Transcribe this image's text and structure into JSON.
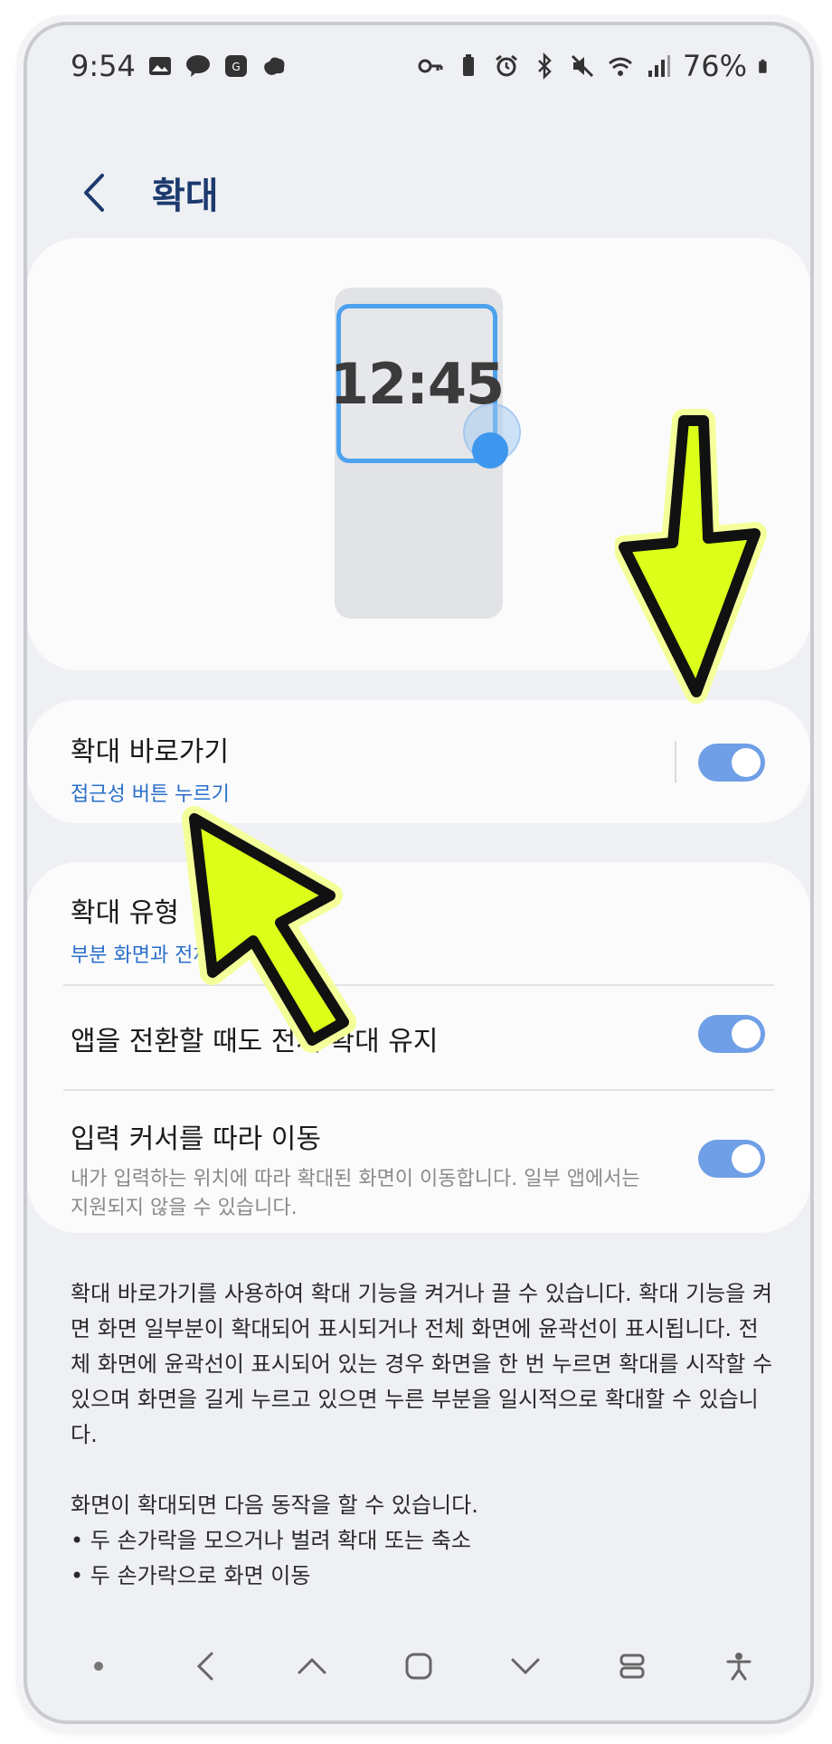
{
  "status_bar": {
    "time": "9:54",
    "battery": "76%",
    "left_icons": [
      "gallery-icon",
      "kakaotalk-icon",
      "g1-icon",
      "cloud-icon"
    ],
    "right_icons": [
      "key-icon",
      "battery-saver-icon",
      "alarm-icon",
      "bluetooth-icon",
      "mute-icon",
      "wifi-icon",
      "signal-icon",
      "battery-icon"
    ]
  },
  "header": {
    "title": "확대"
  },
  "preview": {
    "clock": "12:45"
  },
  "shortcut": {
    "title": "확대 바로가기",
    "subtitle": "접근성 버튼 누르기",
    "toggle_on": true
  },
  "settings": [
    {
      "title": "확대 유형",
      "subtitle": "부분 화면과 전체"
    },
    {
      "title": "앱을 전환할 때도 전체 확대 유지",
      "toggle_on": true
    },
    {
      "title": "입력 커서를 따라 이동",
      "description": "내가 입력하는 위치에 따라 확대된 화면이 이동합니다. 일부 앱에서는 지원되지 않을 수 있습니다.",
      "toggle_on": true
    }
  ],
  "description": {
    "para1": "확대 바로가기를 사용하여 확대 기능을 켜거나 끌 수 있습니다. 확대 기능을 켜면 화면 일부분이 확대되어 표시되거나 전체 화면에 윤곽선이 표시됩니다. 전체 화면에 윤곽선이 표시되어 있는 경우 화면을 한 번 누르면 확대를 시작할 수 있으며 화면을 길게 누르고 있으면 누른 부분을 일시적으로 확대할 수 있습니다.",
    "para2": "화면이 확대되면 다음 동작을 할 수 있습니다.",
    "bullet1": "• 두 손가락을 모으거나 벌려 확대 또는 축소",
    "bullet2": "• 두 손가락으로 화면 이동"
  },
  "colors": {
    "accent": "#2a6fc9",
    "toggle": "#6f9fe6",
    "annotation_arrow": "#dcff1a"
  }
}
